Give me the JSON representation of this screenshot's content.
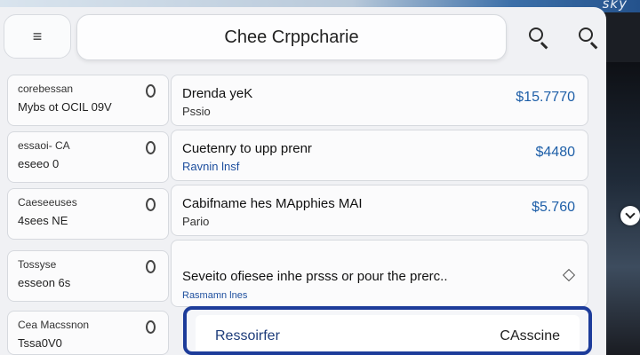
{
  "header": {
    "watermark": "sky",
    "menu_icon": "≡",
    "title": "Chee Crppcharie"
  },
  "sidebar": {
    "items": [
      {
        "line1": "corebessan",
        "line2": "Mybs ot OCIL 09V"
      },
      {
        "line1": "essaoi- CA",
        "line2": "eseeo 0"
      },
      {
        "line1": "Caeseeuses",
        "line2": "4sees NE"
      },
      {
        "line1": "Tossyse",
        "line2": "esseon 6s"
      },
      {
        "line1": "Cea Macssnon",
        "line2": "Tssa0V0"
      }
    ]
  },
  "cards": [
    {
      "title": "Drenda yeK",
      "sub": "Pssio",
      "price": "$15.7770"
    },
    {
      "title": "Cuetenry to upp prenr",
      "sub": "Ravnin lnsf",
      "price": "$4480"
    },
    {
      "title": "Cabifname hes MApphies MAI",
      "sub": "Pario",
      "price": "$5.760"
    },
    {
      "title": "Seveito ofiesee inhe prsss or pour the prerc..",
      "sub": "Rasmamn lnes",
      "price": ""
    }
  ],
  "bottom": {
    "left_label": "Ressoirfer",
    "right_label": "CAsscine"
  },
  "colors": {
    "accent": "#1d3c9a",
    "price": "#1e5fa8"
  }
}
